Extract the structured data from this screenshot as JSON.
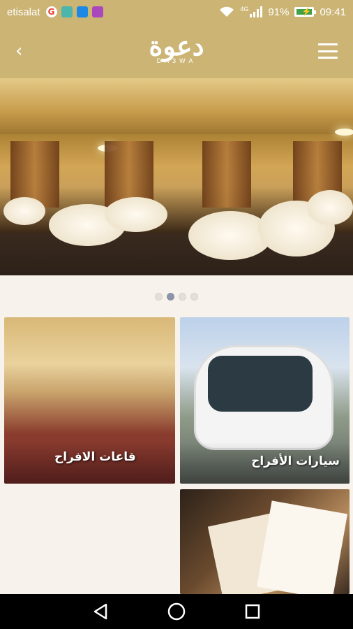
{
  "status_bar": {
    "carrier": "etisalat",
    "network": "4G",
    "battery": "91%",
    "battery_level": 0.91,
    "time": "09:41",
    "colors": {
      "bar": "#cbb474"
    }
  },
  "header": {
    "logo_arabic": "دعوة",
    "logo_english": "DA3WA",
    "back_icon": "chevron-left-icon",
    "menu_icon": "hamburger-menu-icon"
  },
  "carousel": {
    "slide_count": 4,
    "active_index": 1
  },
  "tiles": [
    {
      "label": "قاعات الافراح"
    },
    {
      "label": "سيارات الأفراح"
    },
    {
      "label": ""
    }
  ],
  "nav": {
    "back": "back-triangle-icon",
    "home": "home-circle-icon",
    "recents": "recents-square-icon"
  }
}
